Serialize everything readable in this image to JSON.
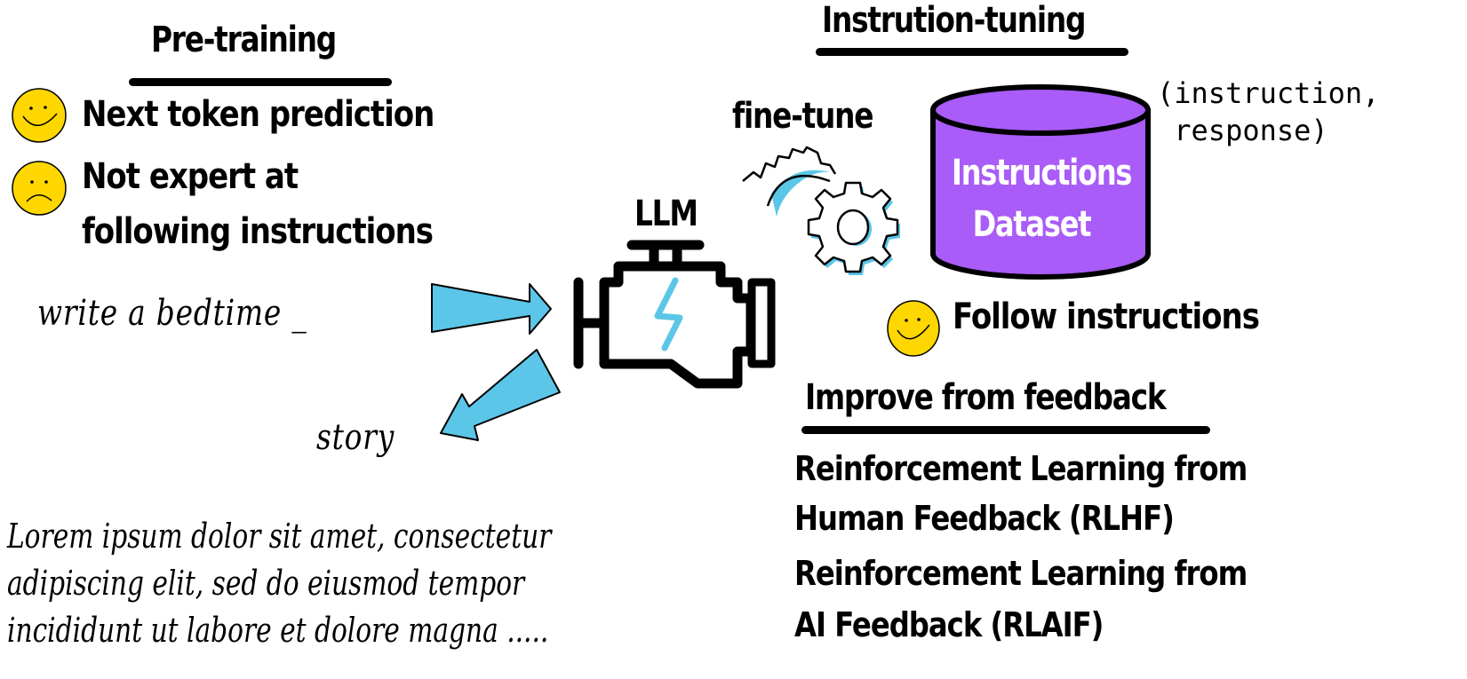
{
  "pretraining": {
    "title": "Pre-training",
    "items": [
      {
        "icon": "happy-face-icon",
        "label": "Next token prediction"
      },
      {
        "icon": "sad-face-icon",
        "label_line1": "Not expert at",
        "label_line2": "following instructions"
      }
    ],
    "prompt": "write a bedtime _",
    "prediction": "story",
    "lorem_lines": [
      "Lorem ipsum dolor sit amet, consectetur",
      "adipiscing elit, sed do eiusmod tempor",
      "incididunt ut labore et dolore magna ....."
    ]
  },
  "llm": {
    "label": "LLM"
  },
  "instruction_tuning": {
    "title": "Instrution-tuning",
    "fine_tune_label": "fine-tune",
    "dataset_line1": "Instructions",
    "dataset_line2": "Dataset",
    "pair_line1": "(instruction,",
    "pair_line2": " response)",
    "result": "Follow instructions"
  },
  "feedback": {
    "title": "Improve from feedback",
    "items": [
      {
        "line1": "Reinforcement Learning from",
        "line2": "Human Feedback (RLHF)"
      },
      {
        "line1": "Reinforcement Learning from",
        "line2": "AI Feedback (RLAIF)"
      }
    ]
  },
  "colors": {
    "accent_blue": "#5bc6e8",
    "dataset_purple": "#a95cf7",
    "smiley_yellow": "#ffd700"
  }
}
